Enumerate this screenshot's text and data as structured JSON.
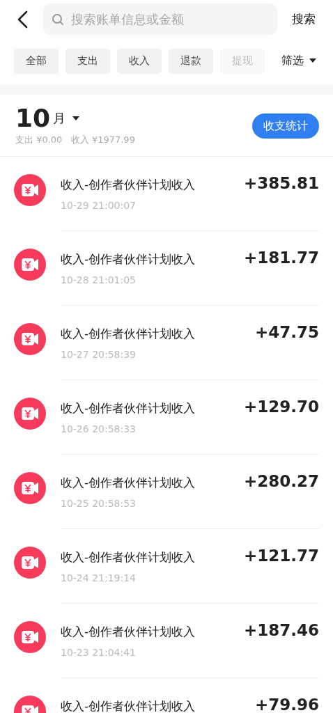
{
  "search": {
    "placeholder": "搜索账单信息或金额",
    "button": "搜索"
  },
  "filters": [
    {
      "label": "全部",
      "faded": false
    },
    {
      "label": "支出",
      "faded": false
    },
    {
      "label": "收入",
      "faded": false
    },
    {
      "label": "退款",
      "faded": false
    },
    {
      "label": "提现",
      "faded": true
    }
  ],
  "filter_menu": "筛选",
  "month": {
    "number": "10",
    "unit": "月",
    "summary": "支出 ¥0.00   收入 ¥1977.99",
    "stats_button": "收支统计"
  },
  "transactions": [
    {
      "title": "收入-创作者伙伴计划收入",
      "time": "10-29 21:00:07",
      "amount": "+385.81"
    },
    {
      "title": "收入-创作者伙伴计划收入",
      "time": "10-28 21:01:05",
      "amount": "+181.77"
    },
    {
      "title": "收入-创作者伙伴计划收入",
      "time": "10-27 20:58:39",
      "amount": "+47.75"
    },
    {
      "title": "收入-创作者伙伴计划收入",
      "time": "10-26 20:58:33",
      "amount": "+129.70"
    },
    {
      "title": "收入-创作者伙伴计划收入",
      "time": "10-25 20:58:53",
      "amount": "+280.27"
    },
    {
      "title": "收入-创作者伙伴计划收入",
      "time": "10-24 21:19:14",
      "amount": "+121.77"
    },
    {
      "title": "收入-创作者伙伴计划收入",
      "time": "10-23 21:04:41",
      "amount": "+187.46"
    },
    {
      "title": "收入-创作者伙伴计划收入",
      "amount": "+79.96"
    }
  ]
}
